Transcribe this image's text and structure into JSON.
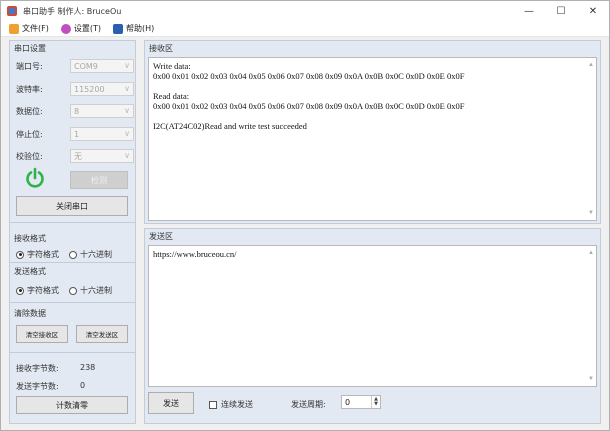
{
  "window": {
    "title": "串口助手 制作人: BruceOu",
    "controls": {
      "minimize": "—",
      "maximize": "☐",
      "close": "✕"
    }
  },
  "menu": [
    {
      "label": "文件(F)",
      "icon": "file-icon"
    },
    {
      "label": "设置(T)",
      "icon": "settings-icon"
    },
    {
      "label": "帮助(H)",
      "icon": "help-icon"
    }
  ],
  "serial": {
    "title": "串口设置",
    "port_label": "端口号:",
    "port_value": "COM9",
    "baud_label": "波特率:",
    "baud_value": "115200",
    "data_label": "数据位:",
    "data_value": "8",
    "stop_label": "停止位:",
    "stop_value": "1",
    "parity_label": "校验位:",
    "parity_value": "无",
    "detect_label": "检测",
    "close_port_label": "关闭串口",
    "power_color": "#2fb34a"
  },
  "recv_format": {
    "title": "接收格式",
    "opt_char": "字符格式",
    "opt_hex": "十六进制"
  },
  "send_format": {
    "title": "发送格式",
    "opt_char": "字符格式",
    "opt_hex": "十六进制"
  },
  "clear": {
    "title": "清除数据",
    "clear_recv": "清空接收区",
    "clear_send": "清空发送区"
  },
  "stats": {
    "recv_label": "接收字节数:",
    "recv_value": "238",
    "send_label": "发送字节数:",
    "send_value": "0",
    "reset_label": "计数清零"
  },
  "recv_area": {
    "title": "接收区",
    "lines": [
      "Write data:",
      "0x00 0x01 0x02 0x03 0x04 0x05 0x06 0x07 0x08 0x09 0x0A 0x0B 0x0C 0x0D 0x0E 0x0F",
      "",
      "Read data:",
      "0x00 0x01 0x02 0x03 0x04 0x05 0x06 0x07 0x08 0x09 0x0A 0x0B 0x0C 0x0D 0x0E 0x0F",
      "",
      "I2C(AT24C02)Read and write test succeeded"
    ]
  },
  "send_area": {
    "title": "发送区",
    "text": "https://www.bruceou.cn/",
    "send_label": "发送",
    "continuous_label": "连续发送",
    "period_label": "发送周期:",
    "period_value": "0"
  }
}
